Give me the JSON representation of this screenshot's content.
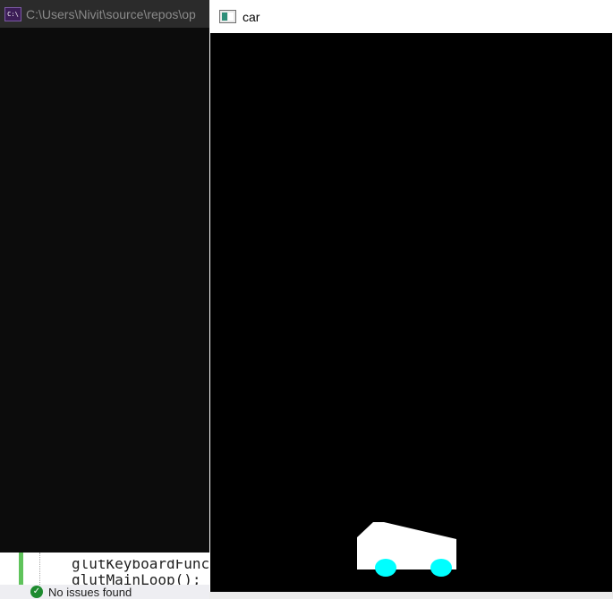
{
  "console": {
    "title": "C:\\Users\\Nivit\\source\\repos\\op",
    "icon": "console-icon",
    "icon_glyph": "C:\\"
  },
  "editor": {
    "line1": "glutKeyboardFunc(",
    "line2": "glutMainLoop();"
  },
  "status_bar": {
    "icon": "check-circle-icon",
    "check_glyph": "✓",
    "text": "No issues found"
  },
  "car_window": {
    "title": "car",
    "icon": "glut-window-icon",
    "canvas_color": "#000000",
    "body_color": "#ffffff",
    "wheel_color": "#00ffff"
  }
}
